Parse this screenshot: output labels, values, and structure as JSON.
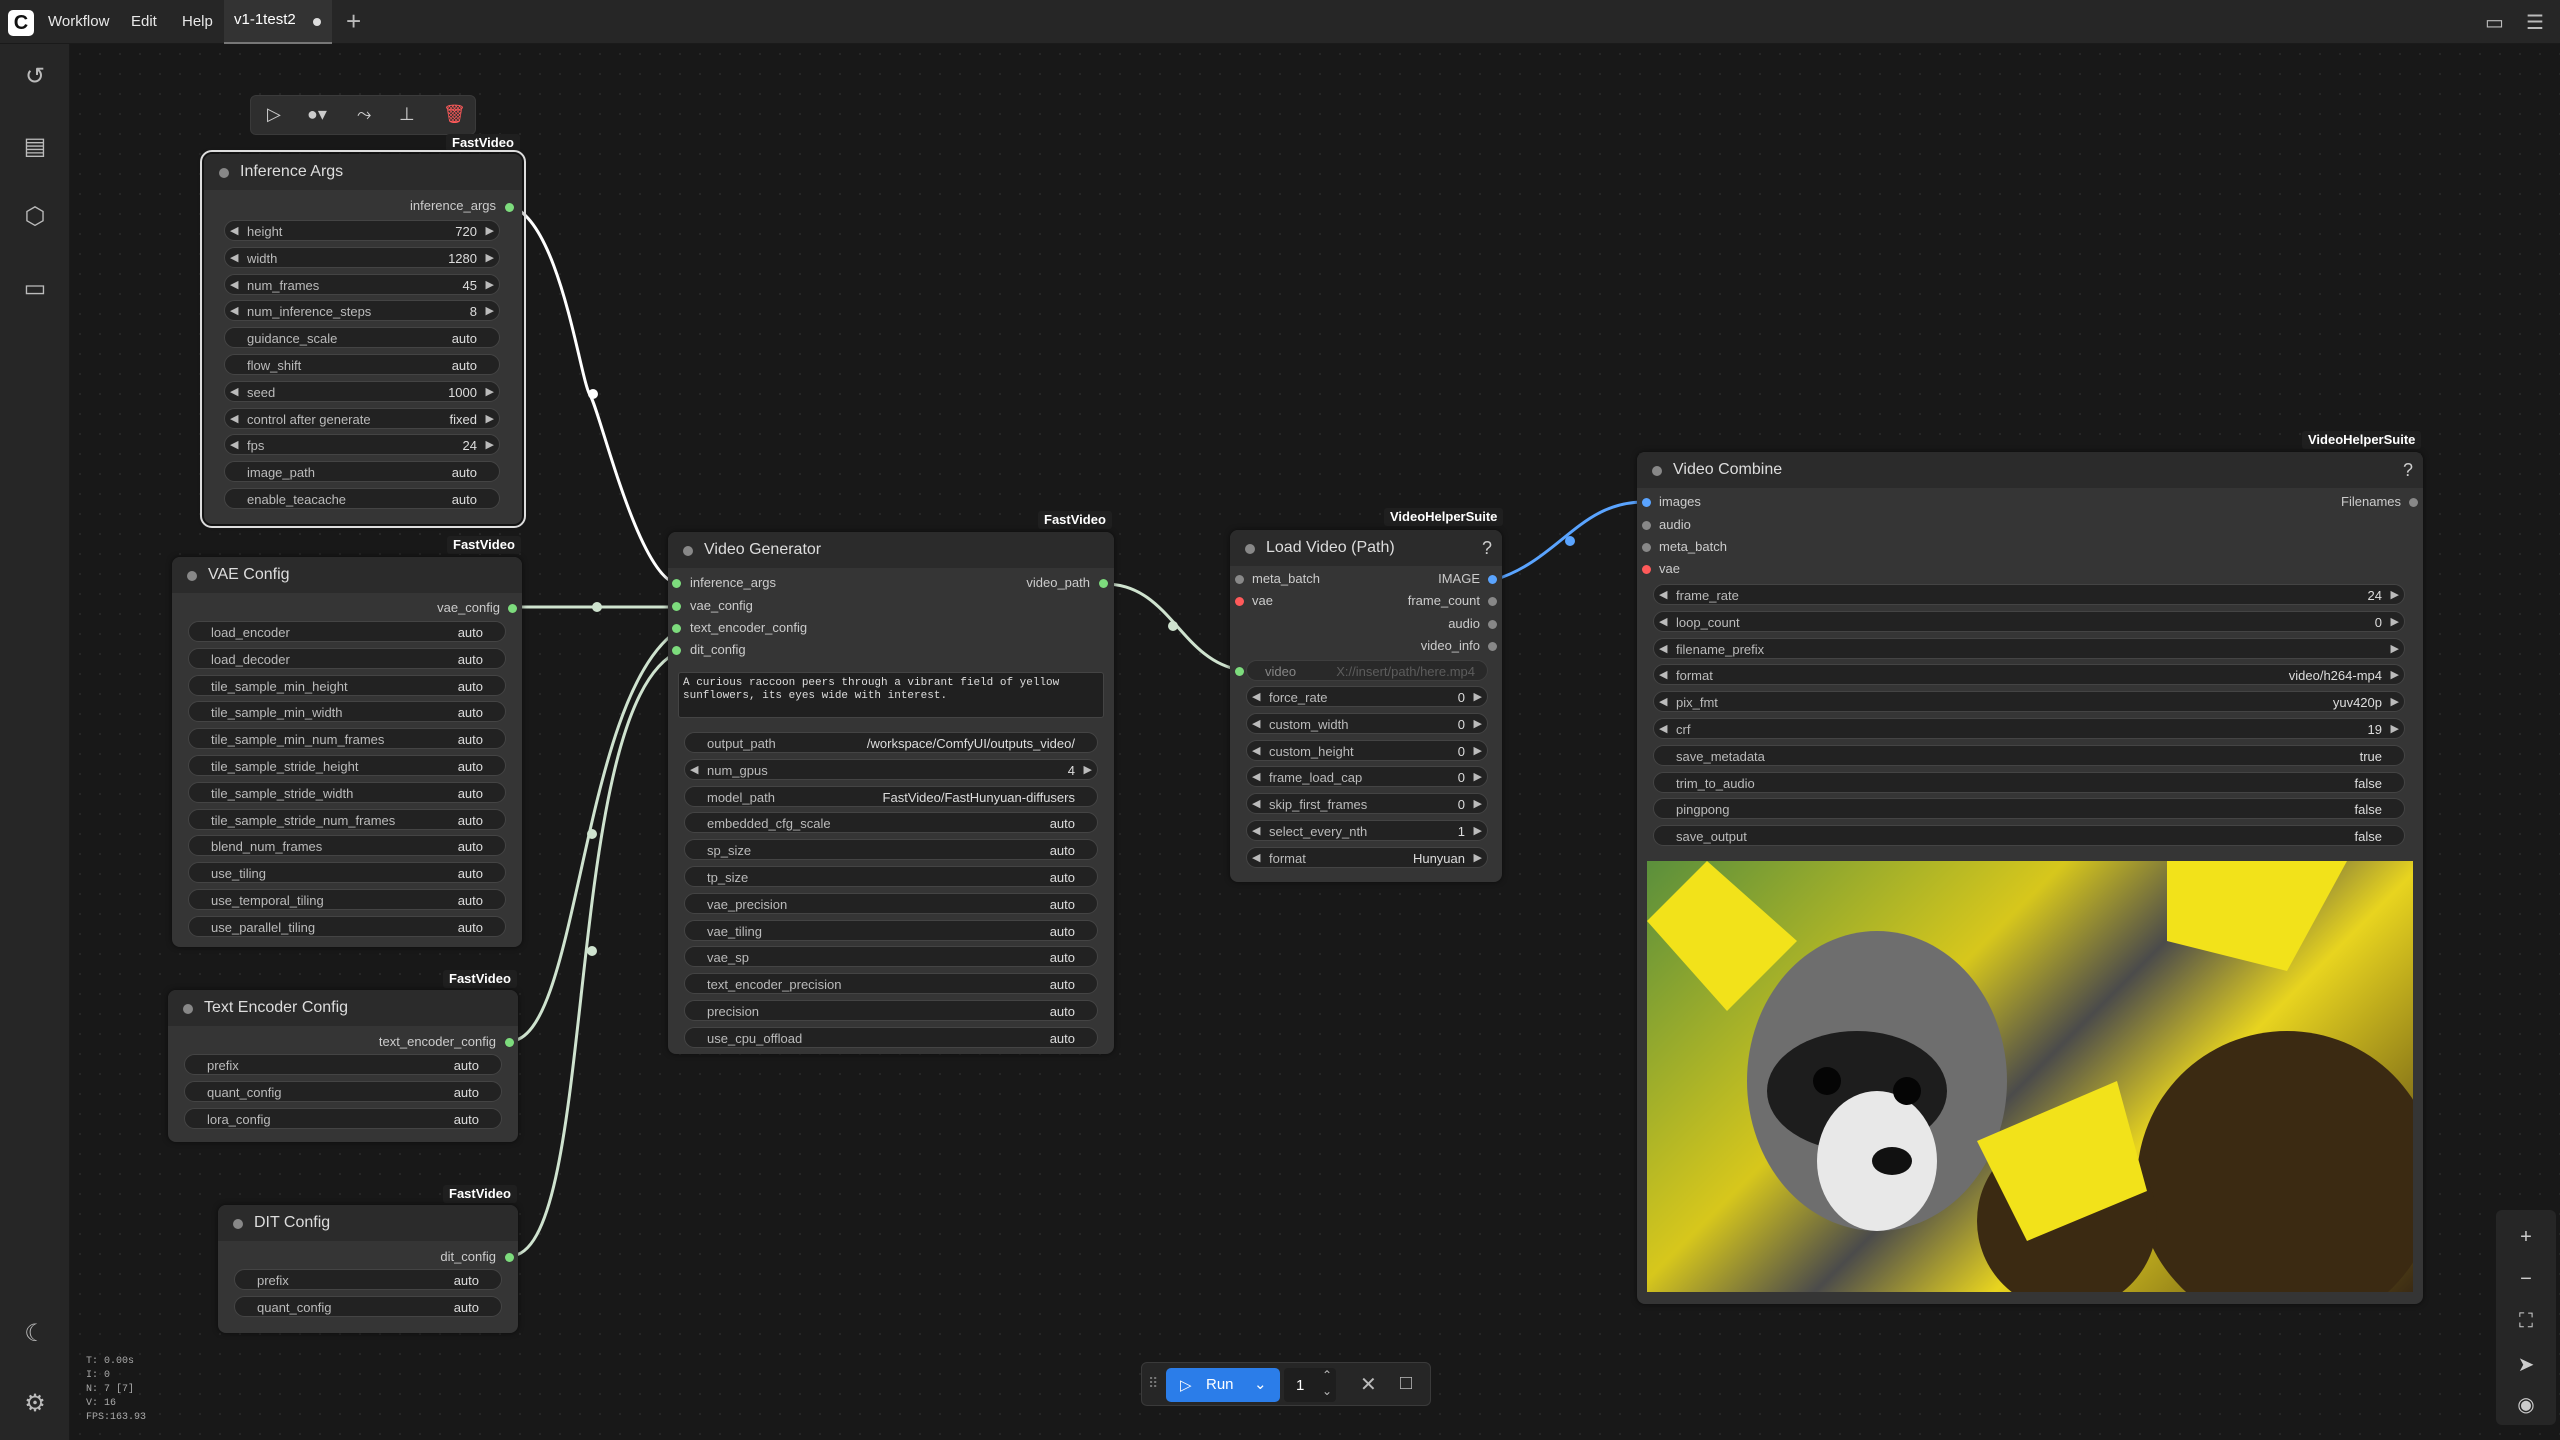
{
  "topbar": {
    "menus": [
      "Workflow",
      "Edit",
      "Help"
    ],
    "tab": "v1-1test2"
  },
  "toolbar": {
    "icons": [
      "play-icon",
      "color-icon",
      "bypass-icon",
      "pin-icon",
      "delete-icon"
    ]
  },
  "inference_args": {
    "title": "Inference Args",
    "badge": "FastVideo",
    "output": "inference_args",
    "widgets": [
      [
        "height",
        "720"
      ],
      [
        "width",
        "1280"
      ],
      [
        "num_frames",
        "45"
      ],
      [
        "num_inference_steps",
        "8"
      ],
      [
        "guidance_scale",
        "auto"
      ],
      [
        "flow_shift",
        "auto"
      ],
      [
        "seed",
        "1000"
      ],
      [
        "control after generate",
        "fixed"
      ],
      [
        "fps",
        "24"
      ],
      [
        "image_path",
        "auto"
      ],
      [
        "enable_teacache",
        "auto"
      ]
    ]
  },
  "vae_config": {
    "title": "VAE Config",
    "badge": "FastVideo",
    "output": "vae_config",
    "widgets": [
      [
        "load_encoder",
        "auto"
      ],
      [
        "load_decoder",
        "auto"
      ],
      [
        "tile_sample_min_height",
        "auto"
      ],
      [
        "tile_sample_min_width",
        "auto"
      ],
      [
        "tile_sample_min_num_frames",
        "auto"
      ],
      [
        "tile_sample_stride_height",
        "auto"
      ],
      [
        "tile_sample_stride_width",
        "auto"
      ],
      [
        "tile_sample_stride_num_frames",
        "auto"
      ],
      [
        "blend_num_frames",
        "auto"
      ],
      [
        "use_tiling",
        "auto"
      ],
      [
        "use_temporal_tiling",
        "auto"
      ],
      [
        "use_parallel_tiling",
        "auto"
      ]
    ]
  },
  "text_encoder_config": {
    "title": "Text Encoder Config",
    "badge": "FastVideo",
    "output": "text_encoder_config",
    "widgets": [
      [
        "prefix",
        "auto"
      ],
      [
        "quant_config",
        "auto"
      ],
      [
        "lora_config",
        "auto"
      ]
    ]
  },
  "dit_config": {
    "title": "DIT Config",
    "badge": "FastVideo",
    "output": "dit_config",
    "widgets": [
      [
        "prefix",
        "auto"
      ],
      [
        "quant_config",
        "auto"
      ]
    ]
  },
  "video_generator": {
    "title": "Video Generator",
    "badge": "FastVideo",
    "inputs": [
      "inference_args",
      "vae_config",
      "text_encoder_config",
      "dit_config"
    ],
    "output": "video_path",
    "prompt": "A curious raccoon peers through a vibrant field of yellow sunflowers, its eyes wide with interest.",
    "widgets": [
      [
        "output_path",
        "/workspace/ComfyUI/outputs_video/"
      ],
      [
        "num_gpus",
        "4"
      ],
      [
        "model_path",
        "FastVideo/FastHunyuan-diffusers"
      ],
      [
        "embedded_cfg_scale",
        "auto"
      ],
      [
        "sp_size",
        "auto"
      ],
      [
        "tp_size",
        "auto"
      ],
      [
        "vae_precision",
        "auto"
      ],
      [
        "vae_tiling",
        "auto"
      ],
      [
        "vae_sp",
        "auto"
      ],
      [
        "text_encoder_precision",
        "auto"
      ],
      [
        "precision",
        "auto"
      ],
      [
        "use_cpu_offload",
        "auto"
      ]
    ]
  },
  "load_video": {
    "title": "Load Video (Path)",
    "badge": "VideoHelperSuite",
    "inputs": [
      "meta_batch",
      "vae"
    ],
    "outputs": [
      "IMAGE",
      "frame_count",
      "audio",
      "video_info"
    ],
    "video_label": "video",
    "video_placeholder": "X://insert/path/here.mp4",
    "widgets": [
      [
        "force_rate",
        "0"
      ],
      [
        "custom_width",
        "0"
      ],
      [
        "custom_height",
        "0"
      ],
      [
        "frame_load_cap",
        "0"
      ],
      [
        "skip_first_frames",
        "0"
      ],
      [
        "select_every_nth",
        "1"
      ],
      [
        "format",
        "Hunyuan"
      ]
    ]
  },
  "video_combine": {
    "title": "Video Combine",
    "badge": "VideoHelperSuite",
    "inputs": [
      "images",
      "audio",
      "meta_batch",
      "vae"
    ],
    "output": "Filenames",
    "widgets": [
      [
        "frame_rate",
        "24"
      ],
      [
        "loop_count",
        "0"
      ],
      [
        "filename_prefix",
        ""
      ],
      [
        "format",
        "video/h264-mp4"
      ],
      [
        "pix_fmt",
        "yuv420p"
      ],
      [
        "crf",
        "19"
      ],
      [
        "save_metadata",
        "true"
      ],
      [
        "trim_to_audio",
        "false"
      ],
      [
        "pingpong",
        "false"
      ],
      [
        "save_output",
        "false"
      ]
    ]
  },
  "runbar": {
    "run": "Run",
    "count": "1"
  },
  "stats": [
    "T: 0.00s",
    "I: 0",
    "N: 7 [7]",
    "V: 16",
    "FPS:163.93"
  ]
}
